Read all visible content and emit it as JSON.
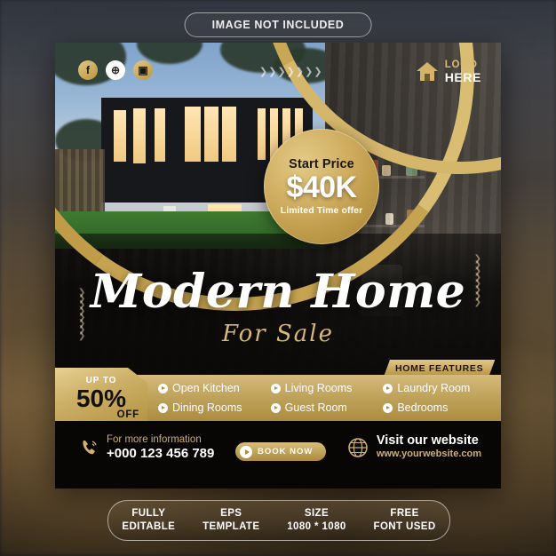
{
  "notice": {
    "label": "IMAGE NOT INCLUDED"
  },
  "socials": [
    {
      "name": "facebook-icon",
      "glyph": "f"
    },
    {
      "name": "globe-icon",
      "glyph": "⊕"
    },
    {
      "name": "instagram-icon",
      "glyph": "▣"
    }
  ],
  "logo": {
    "icon": "house-icon",
    "line1": "LOGO",
    "line2": "HERE"
  },
  "badge": {
    "top": "Start Price",
    "price": "$40K",
    "bottom": "Limited Time offer"
  },
  "headline": {
    "title": "Modern Home",
    "subtitle": "For Sale"
  },
  "ribbon": {
    "label": "HOME FEATURES"
  },
  "discount": {
    "up_to": "UP TO",
    "percent": "50%",
    "off": "OFF"
  },
  "features": [
    [
      "Open Kitchen",
      "Dining Rooms"
    ],
    [
      "Living Rooms",
      "Guest Room"
    ],
    [
      "Laundry Room",
      "Bedrooms"
    ]
  ],
  "contact": {
    "phone_icon": "phone-icon",
    "phone_label": "For more information",
    "phone_number": "+000 123 456 789",
    "book_button": "BOOK NOW",
    "book_icon": "arrow-right-circle-icon",
    "web_icon": "globe-icon",
    "web_label": "Visit our website",
    "web_url": "www.yourwebsite.com"
  },
  "footer": [
    {
      "top": "FULLY",
      "bottom": "EDITABLE"
    },
    {
      "top": "EPS",
      "bottom": "TEMPLATE"
    },
    {
      "top": "SIZE",
      "bottom": "1080 * 1080"
    },
    {
      "top": "FREE",
      "bottom": "FONT USED"
    }
  ],
  "colors": {
    "gold": "#c6a350",
    "gold_light": "#e3ca86",
    "gold_dark": "#9d7d31",
    "dark": "#070605",
    "white": "#ffffff"
  }
}
